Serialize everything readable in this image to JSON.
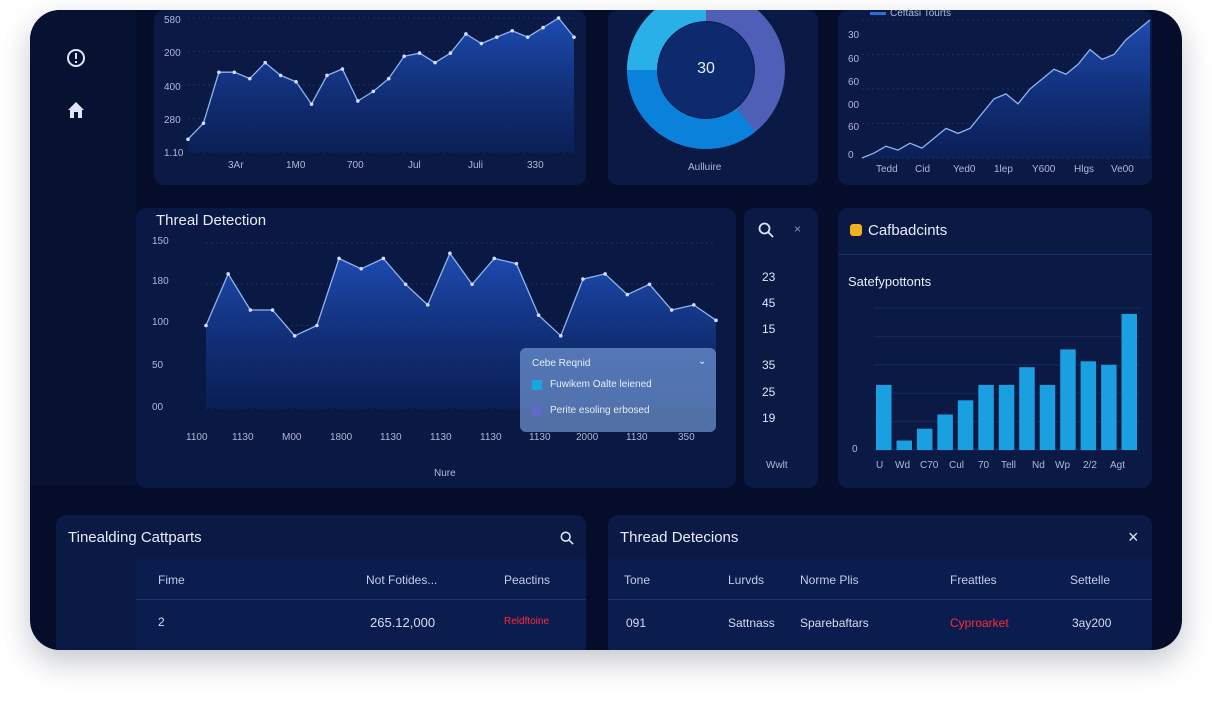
{
  "sidebar": {
    "icons": [
      "alert-icon",
      "home-icon"
    ]
  },
  "top_left_chart": {
    "y_ticks": [
      "580",
      "200",
      "400",
      "280",
      "1.10"
    ],
    "x_ticks": [
      "3Ar",
      "1M0",
      "700",
      "Jul",
      "Juli",
      "330"
    ],
    "chart_data": {
      "type": "area",
      "x": [
        1,
        2,
        3,
        4,
        5,
        6,
        7,
        8,
        9,
        10,
        11,
        12,
        13,
        14,
        15,
        16,
        17,
        18,
        19,
        20,
        21,
        22,
        23,
        24,
        25,
        26
      ],
      "values": [
        280,
        305,
        385,
        385,
        375,
        400,
        380,
        370,
        335,
        380,
        390,
        340,
        355,
        375,
        410,
        415,
        400,
        415,
        445,
        430,
        440,
        450,
        440,
        455,
        470,
        440
      ]
    }
  },
  "donut": {
    "center": "30",
    "label": "Aulluire",
    "colors": [
      "#3f56b0",
      "#0a7fd6",
      "#23a3e0"
    ]
  },
  "top_right_chart": {
    "legend": "Ceftasi Tourts",
    "y_ticks": [
      "30",
      "60",
      "60",
      "00",
      "60",
      "0"
    ],
    "x_ticks": [
      "Tedd",
      "Cid",
      "Yed0",
      "1lep",
      "Y600",
      "Hlgs",
      "Ve00"
    ],
    "chart_data": {
      "type": "area",
      "values": [
        0,
        5,
        12,
        8,
        15,
        10,
        20,
        30,
        25,
        30,
        45,
        60,
        65,
        55,
        70,
        80,
        90,
        85,
        95,
        110,
        100,
        105,
        120,
        130,
        140
      ]
    }
  },
  "threat_detection": {
    "title": "Threal Detection",
    "y_ticks": [
      "150",
      "180",
      "100",
      "50",
      "00"
    ],
    "x_ticks": [
      "1100",
      "1130",
      "M00",
      "1800",
      "1130",
      "1130",
      "1130",
      "1130",
      "2000",
      "1130",
      "350"
    ],
    "x_label": "Nure",
    "legend": {
      "title": "Cebe Reqnid",
      "items": [
        "Fuwikem Oalte leiened",
        "Perite esoling erbosed"
      ]
    },
    "chart_data": {
      "type": "area",
      "values": [
        80,
        130,
        95,
        95,
        70,
        80,
        145,
        135,
        145,
        120,
        100,
        150,
        120,
        145,
        140,
        90,
        70,
        125,
        130,
        110,
        120,
        95,
        100,
        85
      ]
    }
  },
  "mid_narrow": {
    "values": [
      "23",
      "45",
      "15",
      "35",
      "25",
      "19"
    ],
    "label": "Wwlt"
  },
  "callback": {
    "title": "Cafbadcints",
    "subtitle": "Satefypottonts",
    "y_ticks": [
      "0"
    ],
    "x_ticks": [
      "U",
      "Wd",
      "C70",
      "Cul",
      "70",
      "Tell",
      "Nd",
      "Wp",
      "2/2",
      "Agt"
    ],
    "chart_data": {
      "type": "bar",
      "values": [
        55,
        8,
        18,
        30,
        42,
        55,
        55,
        70,
        55,
        85,
        75,
        72,
        115
      ]
    }
  },
  "tinealding": {
    "title": "Tinealding Cattparts",
    "headers": [
      "Fime",
      "Not Fotides...",
      "Peactins"
    ],
    "row": [
      "2",
      "265.12,000",
      "Reldftoine"
    ]
  },
  "detections": {
    "title": "Thread Detecions",
    "headers": [
      "Tone",
      "Lurvds",
      "Norme Plis",
      "Freattles",
      "Settelle"
    ],
    "row": [
      "091",
      "Sattnass",
      "Sparebaftars",
      "Cyproarket",
      "3ay200"
    ]
  }
}
